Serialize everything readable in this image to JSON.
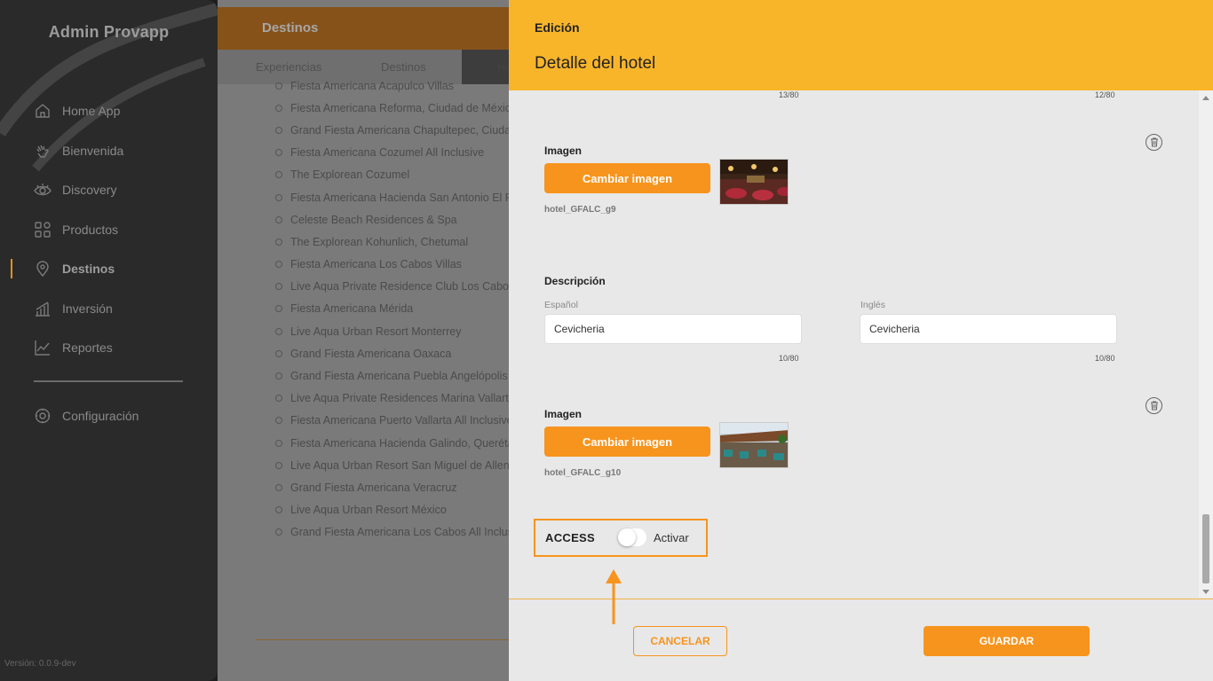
{
  "sidebar": {
    "brand": "Admin Provapp",
    "items": [
      {
        "label": "Home App",
        "icon": "home-icon"
      },
      {
        "label": "Bienvenida",
        "icon": "hand-wave-icon"
      },
      {
        "label": "Discovery",
        "icon": "eye-icon"
      },
      {
        "label": "Productos",
        "icon": "grid-icon"
      },
      {
        "label": "Destinos",
        "icon": "map-pin-icon",
        "active": true
      },
      {
        "label": "Inversión",
        "icon": "bar-chart-icon"
      },
      {
        "label": "Reportes",
        "icon": "line-chart-icon"
      },
      {
        "label": "Configuración",
        "icon": "gear-icon"
      }
    ],
    "version": "Versión: 0.0.9-dev"
  },
  "background": {
    "header_title": "Destinos",
    "tabs": [
      "Experiencias",
      "Destinos",
      "Ho"
    ],
    "hotels": [
      "Fiesta Americana Acapulco Villas",
      "Fiesta Americana Reforma, Ciudad de México",
      "Grand Fiesta Americana Chapultepec, Ciudad de México",
      "Fiesta Americana Cozumel All Inclusive",
      "The Explorean Cozumel",
      "Fiesta Americana Hacienda San Antonio El Puente",
      "Celeste Beach Residences & Spa",
      "The Explorean Kohunlich, Chetumal",
      "Fiesta Americana Los Cabos Villas",
      "Live Aqua Private Residence Club Los Cabos",
      "Fiesta Americana Mérida",
      "Live Aqua Urban Resort Monterrey",
      "Grand Fiesta Americana Oaxaca",
      "Grand Fiesta Americana Puebla Angelópolis",
      "Live Aqua Private Residences Marina Vallarta",
      "Fiesta Americana Puerto Vallarta All Inclusive",
      "Fiesta Americana Hacienda Galindo, Querétaro",
      "Live Aqua Urban Resort San Miguel de Allende",
      "Grand Fiesta Americana Veracruz",
      "Live Aqua Urban Resort México",
      "Grand Fiesta Americana Los Cabos All Inclusive"
    ]
  },
  "modal": {
    "eyebrow": "Edición",
    "title": "Detalle del hotel",
    "top_counters": {
      "es": "13/80",
      "en": "12/80"
    },
    "image1": {
      "label": "Imagen",
      "button": "Cambiar imagen",
      "filename": "hotel_GFALC_g9"
    },
    "description": {
      "label": "Descripción",
      "es_label": "Español",
      "en_label": "Inglés",
      "es_value": "Cevicheria",
      "en_value": "Cevicheria",
      "es_counter": "10/80",
      "en_counter": "10/80"
    },
    "image2": {
      "label": "Imagen",
      "button": "Cambiar imagen",
      "filename": "hotel_GFALC_g10"
    },
    "access": {
      "label": "ACCESS",
      "toggle_label": "Activar",
      "enabled": false
    },
    "footer": {
      "cancel": "CANCELAR",
      "save": "GUARDAR"
    }
  },
  "colors": {
    "accent": "#f7941d",
    "header": "#f9b52a",
    "sidebar": "#2a2a2a"
  }
}
